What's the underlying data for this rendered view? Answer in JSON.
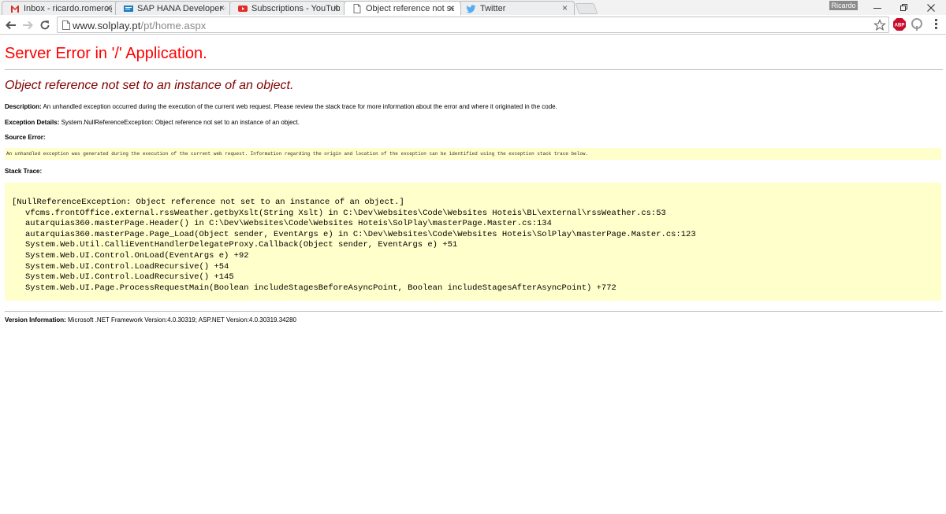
{
  "browser": {
    "tabs": [
      {
        "title": "Inbox - ricardo.romero@t",
        "icon": "gmail-icon",
        "active": false
      },
      {
        "title": "SAP HANA Developer Qu",
        "icon": "sap-icon",
        "active": false
      },
      {
        "title": "Subscriptions - YouTube",
        "icon": "youtube-icon",
        "active": false
      },
      {
        "title": "Object reference not set t",
        "icon": "page-icon",
        "active": true
      },
      {
        "title": "Twitter",
        "icon": "twitter-icon",
        "active": false
      }
    ],
    "close_glyph": "×",
    "profile_name": "Ricardo",
    "url_host": "www.solplay.pt",
    "url_path": "/pt/home.aspx",
    "extensions": [
      {
        "name": "adblock-plus-icon",
        "label": "ABP",
        "color": "#c70d2c"
      },
      {
        "name": "extension-icon",
        "label": "",
        "color": "#9a9a9a"
      }
    ]
  },
  "error_page": {
    "title": "Server Error in '/' Application.",
    "subtitle": "Object reference not set to an instance of an object.",
    "description_label": "Description:",
    "description_text": "An unhandled exception occurred during the execution of the current web request. Please review the stack trace for more information about the error and where it originated in the code.",
    "exception_label": "Exception Details:",
    "exception_text": "System.NullReferenceException: Object reference not set to an instance of an object.",
    "source_error_label": "Source Error:",
    "source_error_text": "An unhandled exception was generated during the execution of the current web request. Information regarding the origin and location of the exception can be identified using the exception stack trace below.",
    "stack_trace_label": "Stack Trace:",
    "stack_header": "[NullReferenceException: Object reference not set to an instance of an object.]",
    "stack_lines": [
      "vfcms.frontOffice.external.rssWeather.getbyXslt(String Xslt) in C:\\Dev\\Websites\\Code\\Websites Hoteis\\BL\\external\\rssWeather.cs:53",
      "autarquias360.masterPage.Header() in C:\\Dev\\Websites\\Code\\Websites Hoteis\\SolPlay\\masterPage.Master.cs:134",
      "autarquias360.masterPage.Page_Load(Object sender, EventArgs e) in C:\\Dev\\Websites\\Code\\Websites Hoteis\\SolPlay\\masterPage.Master.cs:123",
      "System.Web.Util.CalliEventHandlerDelegateProxy.Callback(Object sender, EventArgs e) +51",
      "System.Web.UI.Control.OnLoad(EventArgs e) +92",
      "System.Web.UI.Control.LoadRecursive() +54",
      "System.Web.UI.Control.LoadRecursive() +145",
      "System.Web.UI.Page.ProcessRequestMain(Boolean includeStagesBeforeAsyncPoint, Boolean includeStagesAfterAsyncPoint) +772"
    ],
    "version_label": "Version Information:",
    "version_text": "Microsoft .NET Framework Version:4.0.30319; ASP.NET Version:4.0.30319.34280"
  }
}
